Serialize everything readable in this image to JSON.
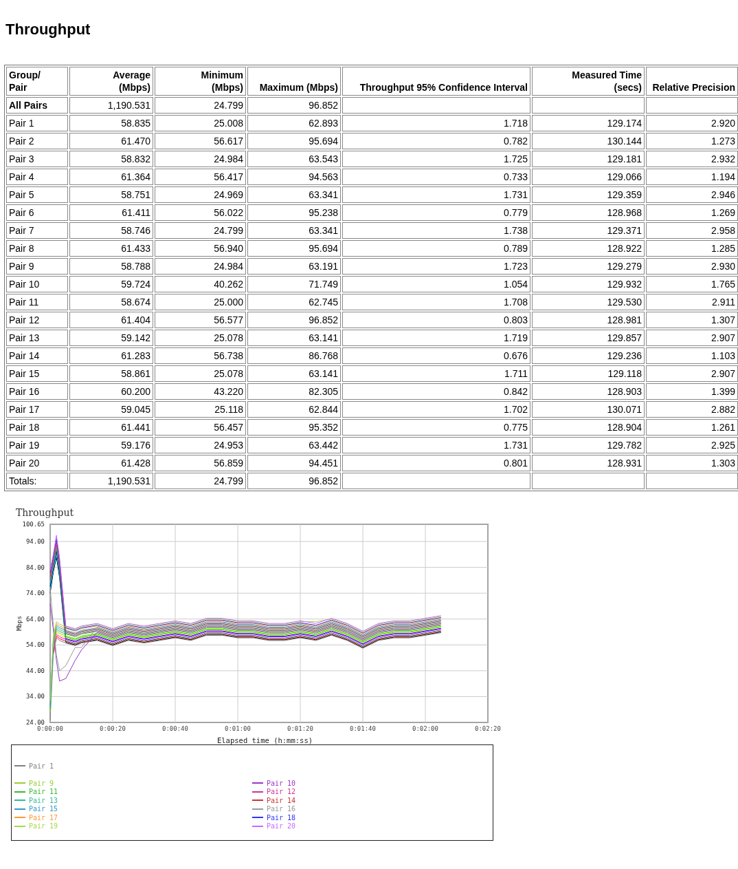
{
  "title": "Throughput",
  "table": {
    "columns": [
      "Group/\nPair",
      "Average\n(Mbps)",
      "Minimum\n(Mbps)",
      "Maximum (Mbps)",
      "Throughput 95% Confidence Interval",
      "Measured Time\n(secs)",
      "Relative Precision"
    ],
    "rows": [
      {
        "kind": "group",
        "cells": [
          "All Pairs",
          "1,190.531",
          "24.799",
          "96.852",
          "",
          "",
          ""
        ]
      },
      {
        "kind": "pair",
        "cells": [
          "Pair 1",
          "58.835",
          "25.008",
          "62.893",
          "1.718",
          "129.174",
          "2.920"
        ]
      },
      {
        "kind": "pair",
        "cells": [
          "Pair 2",
          "61.470",
          "56.617",
          "95.694",
          "0.782",
          "130.144",
          "1.273"
        ]
      },
      {
        "kind": "pair",
        "cells": [
          "Pair 3",
          "58.832",
          "24.984",
          "63.543",
          "1.725",
          "129.181",
          "2.932"
        ]
      },
      {
        "kind": "pair",
        "cells": [
          "Pair 4",
          "61.364",
          "56.417",
          "94.563",
          "0.733",
          "129.066",
          "1.194"
        ]
      },
      {
        "kind": "pair",
        "cells": [
          "Pair 5",
          "58.751",
          "24.969",
          "63.341",
          "1.731",
          "129.359",
          "2.946"
        ]
      },
      {
        "kind": "pair",
        "cells": [
          "Pair 6",
          "61.411",
          "56.022",
          "95.238",
          "0.779",
          "128.968",
          "1.269"
        ]
      },
      {
        "kind": "pair",
        "cells": [
          "Pair 7",
          "58.746",
          "24.799",
          "63.341",
          "1.738",
          "129.371",
          "2.958"
        ]
      },
      {
        "kind": "pair",
        "cells": [
          "Pair 8",
          "61.433",
          "56.940",
          "95.694",
          "0.789",
          "128.922",
          "1.285"
        ]
      },
      {
        "kind": "pair",
        "cells": [
          "Pair 9",
          "58.788",
          "24.984",
          "63.191",
          "1.723",
          "129.279",
          "2.930"
        ]
      },
      {
        "kind": "pair",
        "cells": [
          "Pair 10",
          "59.724",
          "40.262",
          "71.749",
          "1.054",
          "129.932",
          "1.765"
        ]
      },
      {
        "kind": "pair",
        "cells": [
          "Pair 11",
          "58.674",
          "25.000",
          "62.745",
          "1.708",
          "129.530",
          "2.911"
        ]
      },
      {
        "kind": "pair",
        "cells": [
          "Pair 12",
          "61.404",
          "56.577",
          "96.852",
          "0.803",
          "128.981",
          "1.307"
        ]
      },
      {
        "kind": "pair",
        "cells": [
          "Pair 13",
          "59.142",
          "25.078",
          "63.141",
          "1.719",
          "129.857",
          "2.907"
        ]
      },
      {
        "kind": "pair",
        "cells": [
          "Pair 14",
          "61.283",
          "56.738",
          "86.768",
          "0.676",
          "129.236",
          "1.103"
        ]
      },
      {
        "kind": "pair",
        "cells": [
          "Pair 15",
          "58.861",
          "25.078",
          "63.141",
          "1.711",
          "129.118",
          "2.907"
        ]
      },
      {
        "kind": "pair",
        "cells": [
          "Pair 16",
          "60.200",
          "43.220",
          "82.305",
          "0.842",
          "128.903",
          "1.399"
        ]
      },
      {
        "kind": "pair",
        "cells": [
          "Pair 17",
          "59.045",
          "25.118",
          "62.844",
          "1.702",
          "130.071",
          "2.882"
        ]
      },
      {
        "kind": "pair",
        "cells": [
          "Pair 18",
          "61.441",
          "56.457",
          "95.352",
          "0.775",
          "128.904",
          "1.261"
        ]
      },
      {
        "kind": "pair",
        "cells": [
          "Pair 19",
          "59.176",
          "24.953",
          "63.442",
          "1.731",
          "129.782",
          "2.925"
        ]
      },
      {
        "kind": "pair",
        "cells": [
          "Pair 20",
          "61.428",
          "56.859",
          "94.451",
          "0.801",
          "128.931",
          "1.303"
        ]
      },
      {
        "kind": "total",
        "cells": [
          "Totals:",
          "1,190.531",
          "24.799",
          "96.852",
          "",
          "",
          ""
        ]
      }
    ]
  },
  "chart": {
    "chart_data": {
      "type": "line",
      "title": "Throughput",
      "xlabel": "Elapsed time (h:mm:ss)",
      "ylabel": "Mbps",
      "grid": true,
      "x": [
        0,
        1,
        2,
        3,
        5,
        8,
        10,
        15,
        20,
        25,
        30,
        35,
        40,
        45,
        50,
        55,
        60,
        65,
        70,
        75,
        80,
        85,
        90,
        95,
        100,
        105,
        110,
        115,
        120,
        125
      ],
      "xlim": [
        0,
        140
      ],
      "ylim": [
        24,
        100.65
      ],
      "xticks": [
        {
          "value": 0,
          "label": "0:00:00"
        },
        {
          "value": 20,
          "label": "0:00:20"
        },
        {
          "value": 40,
          "label": "0:00:40"
        },
        {
          "value": 60,
          "label": "0:01:00"
        },
        {
          "value": 80,
          "label": "0:01:20"
        },
        {
          "value": 100,
          "label": "0:01:40"
        },
        {
          "value": 120,
          "label": "0:02:00"
        },
        {
          "value": 140,
          "label": "0:02:20"
        }
      ],
      "yticks": [
        {
          "value": 24,
          "label": "24.00"
        },
        {
          "value": 34,
          "label": "34.00"
        },
        {
          "value": 44,
          "label": "44.00"
        },
        {
          "value": 54,
          "label": "54.00"
        },
        {
          "value": 64,
          "label": "64.00"
        },
        {
          "value": 74,
          "label": "74.00"
        },
        {
          "value": 84,
          "label": "84.00"
        },
        {
          "value": 94,
          "label": "94.00"
        },
        {
          "value": 100.65,
          "label": "100.65"
        }
      ],
      "series": [
        {
          "name": "Pair 1",
          "color": "#808080",
          "values": [
            25.0,
            50.0,
            56.7,
            55.7,
            54.7,
            53.7,
            54.7,
            55.7,
            53.7,
            55.7,
            54.7,
            55.7,
            56.7,
            55.7,
            57.7,
            57.7,
            56.7,
            56.7,
            55.7,
            55.7,
            56.7,
            55.7,
            57.7,
            55.7,
            52.7,
            55.7,
            56.7,
            56.7,
            57.7,
            58.7
          ]
        },
        {
          "color": "#000000",
          "values": [
            74.0,
            82.0,
            88.0,
            80.0,
            55.0,
            54.0,
            55.0,
            56,
            54,
            56,
            55,
            56,
            57,
            56,
            58,
            58,
            57,
            57,
            56,
            56,
            57,
            56,
            58,
            56,
            53,
            56,
            57,
            57,
            58,
            59
          ]
        },
        {
          "color": "#ff0000",
          "values": [
            null,
            50.8,
            57.4,
            56.4,
            55.4,
            54.4,
            55.4,
            56.4,
            54.4,
            56.4,
            55.4,
            56.4,
            57.4,
            56.4,
            58.4,
            58.4,
            57.4,
            57.4,
            56.4,
            56.4,
            57.4,
            56.4,
            58.4,
            56.4,
            53.4,
            56.4,
            57.4,
            57.4,
            58.4,
            59.4
          ]
        },
        {
          "color": "#00cccc",
          "values": [
            75.3,
            83.0,
            89.2,
            81.1,
            55.7,
            54.7,
            55.7,
            56.7,
            54.7,
            56.7,
            55.7,
            56.7,
            57.7,
            56.7,
            58.7,
            58.7,
            57.7,
            57.7,
            56.7,
            56.7,
            57.7,
            56.7,
            58.7,
            56.7,
            53.7,
            56.7,
            57.7,
            57.7,
            58.7,
            59.7
          ]
        },
        {
          "color": "#ff00ff",
          "values": [
            null,
            51.6,
            58.1,
            57.1,
            56.1,
            55.1,
            56.1,
            57.1,
            55.1,
            57.1,
            56.1,
            57.1,
            58.1,
            57.1,
            59.1,
            59.1,
            58.1,
            58.1,
            57.1,
            57.1,
            58.1,
            57.1,
            59.1,
            57.1,
            54.1,
            57.1,
            58.1,
            58.1,
            59.1,
            60.1
          ]
        },
        {
          "color": "#0000ff",
          "values": [
            76.6,
            84.0,
            90.4,
            82.2,
            56.4,
            55.4,
            56.4,
            57.4,
            55.4,
            57.4,
            56.4,
            57.4,
            58.4,
            57.4,
            59.4,
            59.4,
            58.4,
            58.4,
            57.4,
            57.4,
            58.4,
            57.4,
            59.4,
            57.4,
            54.4,
            57.4,
            58.4,
            58.4,
            59.4,
            60.4
          ]
        },
        {
          "color": "#dddd00",
          "values": [
            null,
            52.4,
            58.8,
            57.8,
            56.8,
            55.8,
            56.8,
            57.8,
            55.8,
            57.8,
            56.8,
            57.8,
            58.8,
            57.8,
            59.8,
            59.8,
            58.8,
            58.8,
            57.8,
            57.8,
            58.8,
            57.8,
            59.8,
            57.8,
            54.8,
            57.8,
            58.8,
            58.8,
            59.8,
            60.8
          ]
        },
        {
          "color": "#00dd00",
          "values": [
            77.9,
            85.0,
            91.6,
            83.3,
            57.1,
            56.1,
            57.1,
            58.1,
            56.1,
            58.1,
            57.1,
            58.1,
            59.1,
            58.1,
            60.1,
            60.1,
            59.1,
            59.1,
            58.1,
            58.1,
            59.1,
            58.1,
            60.1,
            58.1,
            55.1,
            58.1,
            59.1,
            59.1,
            60.1,
            61.1
          ]
        },
        {
          "name": "Pair 9",
          "color": "#99cc33",
          "values": [
            28.2,
            53.2,
            59.5,
            58.5,
            57.5,
            56.5,
            57.5,
            58.5,
            56.5,
            58.5,
            57.5,
            58.5,
            59.5,
            58.5,
            60.5,
            60.5,
            59.5,
            59.5,
            58.5,
            58.5,
            59.5,
            58.5,
            60.5,
            58.5,
            55.5,
            58.5,
            59.5,
            59.5,
            60.5,
            61.5
          ]
        },
        {
          "name": "Pair 10",
          "color": "#9933cc",
          "values": [
            70,
            60,
            48,
            40,
            41,
            48,
            52,
            58.8,
            56.8,
            58.8,
            57.8,
            58.8,
            59.8,
            58.8,
            60.8,
            60.8,
            59.8,
            59.8,
            58.8,
            58.8,
            59.8,
            58.8,
            60.8,
            58.8,
            55.8,
            58.8,
            59.8,
            59.8,
            60.8,
            61.8
          ]
        },
        {
          "name": "Pair 11",
          "color": "#33bb33",
          "values": [
            29.0,
            54.0,
            60.2,
            59.2,
            58.2,
            57.2,
            58.2,
            59.2,
            57.2,
            59.2,
            58.2,
            59.2,
            60.2,
            59.2,
            61.2,
            61.2,
            60.2,
            60.2,
            59.2,
            59.2,
            60.2,
            59.2,
            61.2,
            59.2,
            56.2,
            59.2,
            60.2,
            60.2,
            61.2,
            62.2
          ]
        },
        {
          "name": "Pair 12",
          "color": "#cc3399",
          "values": [
            79.2,
            86.0,
            92.8,
            84.4,
            58.5,
            57.5,
            58.5,
            59.5,
            57.5,
            59.5,
            58.5,
            59.5,
            60.5,
            59.5,
            61.5,
            61.5,
            60.5,
            60.5,
            59.5,
            59.5,
            60.5,
            59.5,
            61.5,
            59.5,
            56.5,
            59.5,
            60.5,
            60.5,
            61.5,
            62.5
          ]
        },
        {
          "name": "Pair 13",
          "color": "#33bb99",
          "values": [
            29.8,
            54.8,
            60.9,
            59.9,
            58.9,
            57.9,
            58.9,
            59.9,
            57.9,
            59.9,
            58.9,
            59.9,
            60.9,
            59.9,
            61.9,
            61.9,
            60.9,
            60.9,
            59.9,
            59.9,
            60.9,
            59.9,
            61.9,
            59.9,
            56.9,
            59.9,
            60.9,
            60.9,
            61.9,
            62.9
          ]
        },
        {
          "name": "Pair 14",
          "color": "#cc3333",
          "values": [
            80.5,
            87.0,
            94.0,
            85.5,
            59.2,
            58.2,
            59.2,
            60.2,
            58.2,
            60.2,
            59.2,
            60.2,
            61.2,
            60.2,
            62.2,
            62.2,
            61.2,
            61.2,
            60.2,
            60.2,
            61.2,
            60.2,
            62.2,
            60.2,
            57.2,
            60.2,
            61.2,
            61.2,
            62.2,
            63.2
          ]
        },
        {
          "name": "Pair 15",
          "color": "#3399cc",
          "values": [
            30.6,
            55.6,
            61.6,
            60.6,
            59.6,
            58.6,
            59.6,
            60.6,
            58.6,
            60.6,
            59.6,
            60.6,
            61.6,
            60.6,
            62.6,
            62.6,
            61.6,
            61.6,
            60.6,
            60.6,
            61.6,
            60.6,
            62.6,
            60.6,
            57.6,
            60.6,
            61.6,
            61.6,
            62.6,
            63.6
          ]
        },
        {
          "name": "Pair 16",
          "color": "#999999",
          "values": [
            76,
            62,
            50,
            44,
            46,
            53,
            53,
            60.9,
            58.9,
            60.9,
            59.9,
            60.9,
            61.9,
            60.9,
            62.9,
            62.9,
            61.9,
            61.9,
            60.9,
            60.9,
            61.9,
            60.9,
            62.9,
            60.9,
            57.9,
            60.9,
            61.9,
            61.9,
            62.9,
            63.9
          ]
        },
        {
          "name": "Pair 17",
          "color": "#ff9933",
          "values": [
            null,
            56.4,
            62.3,
            61.3,
            60.3,
            59.3,
            60.3,
            61.3,
            59.3,
            61.3,
            60.3,
            61.3,
            62.3,
            61.3,
            63.3,
            63.3,
            62.3,
            62.3,
            61.3,
            61.3,
            62.3,
            61.3,
            63.3,
            61.3,
            58.3,
            61.3,
            62.3,
            62.3,
            63.3,
            64.3
          ]
        },
        {
          "name": "Pair 18",
          "color": "#3333ff",
          "values": [
            81.8,
            88.0,
            95.2,
            86.6,
            60.6,
            59.6,
            60.6,
            61.6,
            59.6,
            61.6,
            60.6,
            61.6,
            62.6,
            61.6,
            63.6,
            63.6,
            62.6,
            62.6,
            61.6,
            61.6,
            62.6,
            61.6,
            63.6,
            61.6,
            58.6,
            61.6,
            62.6,
            62.6,
            63.6,
            64.6
          ]
        },
        {
          "name": "Pair 19",
          "color": "#a8d84a",
          "values": [
            32.2,
            57.2,
            63.0,
            62.0,
            61.0,
            60.0,
            61.0,
            62,
            60,
            62,
            61,
            62,
            63,
            62,
            64,
            64,
            63,
            63,
            62,
            62,
            63,
            63,
            64,
            62,
            59,
            62,
            63,
            63,
            64,
            65
          ]
        },
        {
          "name": "Pair 20",
          "color": "#cc66ff",
          "values": [
            83.1,
            89.0,
            96.4,
            87.7,
            61.3,
            60.3,
            61.3,
            62.3,
            60.3,
            62.3,
            61.3,
            62.3,
            63.3,
            62.3,
            64.3,
            64.3,
            63.3,
            63.3,
            62.3,
            62.3,
            63.3,
            62.3,
            64.3,
            62.3,
            59.3,
            62.3,
            63.3,
            63.3,
            64.3,
            65.3
          ]
        }
      ]
    }
  }
}
